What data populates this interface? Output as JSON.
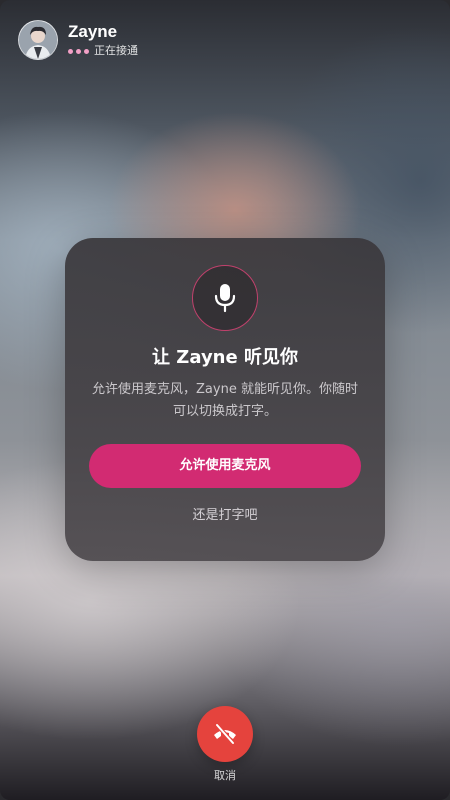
{
  "caller": {
    "name": "Zayne",
    "status": "正在接通",
    "avatar_icon": "user-avatar-icon"
  },
  "permission_dialog": {
    "icon": "microphone-icon",
    "title": "让 Zayne 听见你",
    "description": "允许使用麦克风，Zayne 就能听见你。你随时可以切换成打字。",
    "allow_button_label": "允许使用麦克风",
    "type_instead_label": "还是打字吧"
  },
  "call_controls": {
    "hangup_icon": "hang-up-phone-icon",
    "cancel_label": "取消"
  },
  "colors": {
    "accent_pink": "#d22b72",
    "hangup_red": "#e5433d",
    "status_dot_pink": "#f2a0c6"
  }
}
